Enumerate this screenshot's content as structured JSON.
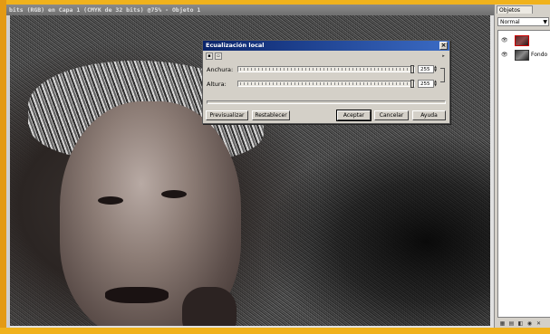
{
  "document": {
    "title": "bits (RGB) en Capa 1 (CMYK de 32 bits) @75% - Objeto 1"
  },
  "dialog": {
    "title": "Ecualización local",
    "close_icon": "close-icon",
    "width_label": "Anchura:",
    "width_value": "255",
    "height_label": "Altura:",
    "height_value": "255",
    "width_level": 1.0,
    "height_level": 1.0,
    "buttons": {
      "preview": "Previsualizar",
      "reset": "Restablecer",
      "accept": "Aceptar",
      "cancel": "Cancelar",
      "help": "Ayuda"
    }
  },
  "panel": {
    "tab": "Objetos",
    "blend_mode": "Normal",
    "layers": [
      {
        "name": "",
        "selected": true
      },
      {
        "name": "Fondo",
        "selected": false
      }
    ]
  },
  "colors": {
    "frame": "#f0b21c",
    "dialog_title_start": "#0a246a",
    "dialog_title_end": "#3b6bc4"
  }
}
